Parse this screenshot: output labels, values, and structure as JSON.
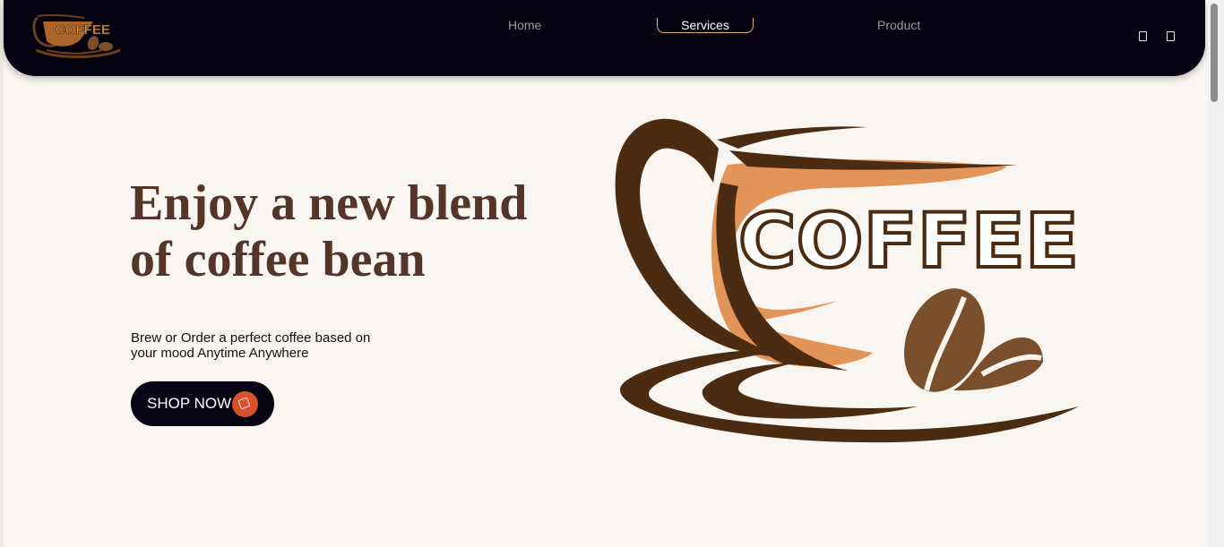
{
  "brand": {
    "logo_text": "COFFEE",
    "logo_icon": "coffee-cup-logo-icon"
  },
  "nav": {
    "links": [
      {
        "label": "Home",
        "active": false
      },
      {
        "label": "Services",
        "active": true
      },
      {
        "label": "Product",
        "active": false
      }
    ],
    "icons": [
      "cart-icon",
      "user-icon"
    ]
  },
  "hero": {
    "title": "Enjoy a new blend of coffee bean",
    "subtitle": "Brew or Order a perfect coffee based on your mood Anytime Anywhere",
    "cta_label": "SHOP NOW",
    "cta_icon": "shop-icon",
    "image_text": "COFFEE",
    "image_icon": "coffee-cup-illustration"
  },
  "colors": {
    "navbar": "#04020f",
    "accent": "#d9502b",
    "title": "#553528",
    "background": "#f9f6f1",
    "cup_brown": "#4b2c13",
    "cup_orange": "#e39459",
    "bean_brown": "#7a4f2b"
  }
}
